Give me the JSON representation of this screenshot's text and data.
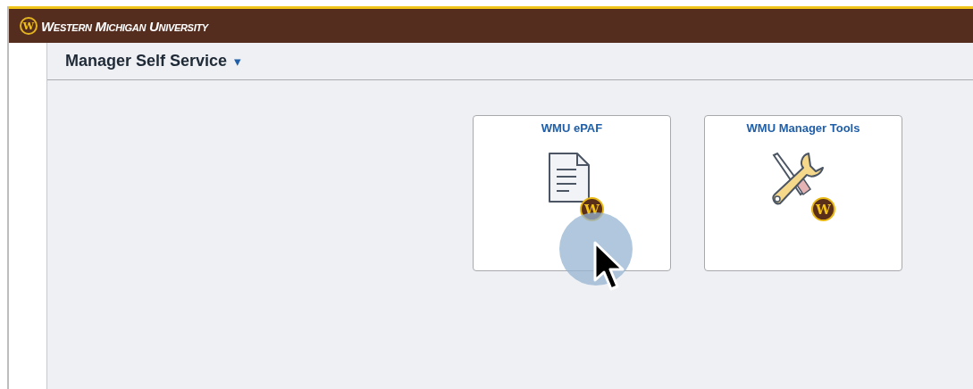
{
  "header": {
    "logo_mark": "W",
    "university": "Western Michigan University"
  },
  "page_title": {
    "label": "Manager Self Service",
    "dropdown": "▾"
  },
  "tiles": [
    {
      "title": "WMU ePAF",
      "kind": "document",
      "badge": "W"
    },
    {
      "title": "WMU Manager Tools",
      "kind": "tools",
      "badge": "W"
    }
  ]
}
